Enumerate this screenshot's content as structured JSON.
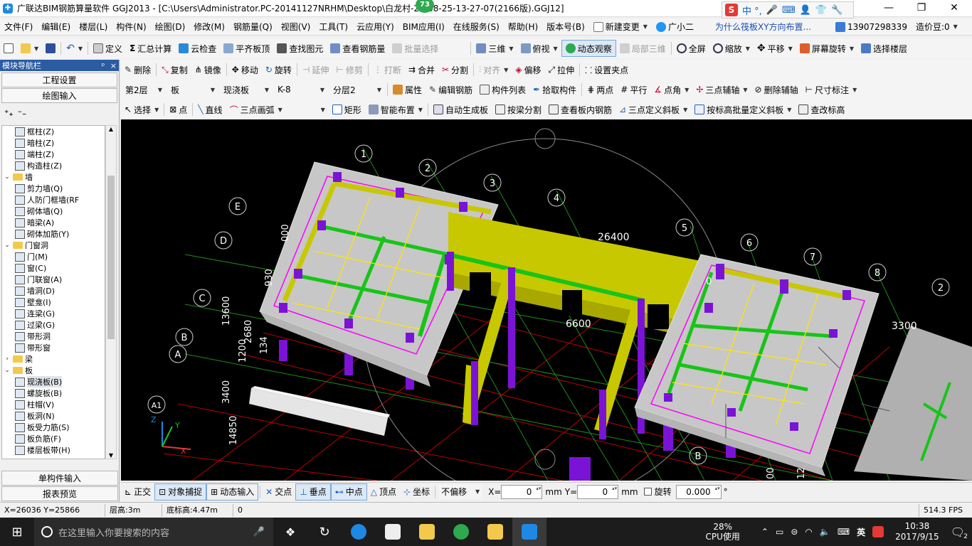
{
  "titlebar": {
    "title": "广联达BIM钢筋算量软件 GGJ2013 - [C:\\Users\\Administrator.PC-20141127NRHM\\Desktop\\白龙村-2…08-25-13-27-07(2166版).GGJ12]",
    "badge": "73",
    "ime_text": "中 °,",
    "ime_logo": "S"
  },
  "menu": {
    "items": [
      "文件(F)",
      "编辑(E)",
      "楼层(L)",
      "构件(N)",
      "绘图(D)",
      "修改(M)",
      "钢筋量(Q)",
      "视图(V)",
      "工具(T)",
      "云应用(Y)",
      "BIM应用(I)",
      "在线服务(S)",
      "帮助(H)",
      "版本号(B)"
    ],
    "new_change": "新建变更",
    "assistant": "广小二",
    "question": "为什么筏板XY方向布置...",
    "phone": "13907298339",
    "beans": "造价豆:0"
  },
  "toolbar1": {
    "define": "定义",
    "sum_calc": "汇总计算",
    "cloud_check": "云检查",
    "flush_top": "平齐板顶",
    "find_element": "查找图元",
    "view_rebar": "查看钢筋量",
    "batch_select": "批量选择",
    "view_3d": "三维",
    "top_view": "俯视",
    "dynamic_view": "动态观察",
    "local_3d": "局部三维",
    "fullscreen": "全屏",
    "zoom": "缩放",
    "pan": "平移",
    "rotate_screen": "屏幕旋转",
    "select_floor": "选择楼层"
  },
  "toolbar2": {
    "delete": "删除",
    "copy": "复制",
    "mirror": "镜像",
    "move": "移动",
    "rotate": "旋转",
    "extend": "延伸",
    "trim": "修剪",
    "break": "打断",
    "merge": "合并",
    "split": "分割",
    "align": "对齐",
    "offset": "偏移",
    "stretch": "拉伸",
    "set_grip": "设置夹点"
  },
  "toolbar3": {
    "floor": "第2层",
    "category": "板",
    "type": "现浇板",
    "element": "K-8",
    "layer": "分层2",
    "attributes": "属性",
    "edit_rebar": "编辑钢筋",
    "component_list": "构件列表",
    "pick_component": "拾取构件",
    "two_points": "两点",
    "parallel": "平行",
    "point_angle": "点角",
    "three_point_axis": "三点辅轴",
    "delete_axis": "删除辅轴",
    "dimension": "尺寸标注"
  },
  "toolbar4": {
    "select": "选择",
    "point": "点",
    "line": "直线",
    "three_point_arc": "三点画弧",
    "rectangle": "矩形",
    "smart_layout": "智能布置",
    "auto_slab": "自动生成板",
    "split_by_beam": "按梁分割",
    "view_slab_rebar": "查看板内钢筋",
    "three_point_slope": "三点定义斜板",
    "batch_slope": "按标高批量定义斜板",
    "modify_elev": "查改标高"
  },
  "nav": {
    "header": "模块导航栏",
    "pin": "ᵖ",
    "close": "×",
    "project_settings": "工程设置",
    "drawing_input": "绘图输入",
    "single_input": "单构件输入",
    "report_preview": "报表预览",
    "tree": [
      {
        "label": "框柱(Z)",
        "level": 2
      },
      {
        "label": "暗柱(Z)",
        "level": 2
      },
      {
        "label": "端柱(Z)",
        "level": 2
      },
      {
        "label": "构造柱(Z)",
        "level": 2
      },
      {
        "label": "墙",
        "level": 1,
        "folder": true,
        "open": true
      },
      {
        "label": "剪力墙(Q)",
        "level": 2
      },
      {
        "label": "人防门框墙(RF",
        "level": 2
      },
      {
        "label": "砌体墙(Q)",
        "level": 2
      },
      {
        "label": "暗梁(A)",
        "level": 2
      },
      {
        "label": "砌体加筋(Y)",
        "level": 2
      },
      {
        "label": "门窗洞",
        "level": 1,
        "folder": true,
        "open": true
      },
      {
        "label": "门(M)",
        "level": 2
      },
      {
        "label": "窗(C)",
        "level": 2
      },
      {
        "label": "门联窗(A)",
        "level": 2
      },
      {
        "label": "墙洞(D)",
        "level": 2
      },
      {
        "label": "壁龛(I)",
        "level": 2
      },
      {
        "label": "连梁(G)",
        "level": 2
      },
      {
        "label": "过梁(G)",
        "level": 2
      },
      {
        "label": "带形洞",
        "level": 2
      },
      {
        "label": "带形窗",
        "level": 2
      },
      {
        "label": "梁",
        "level": 1,
        "folder": true,
        "open": false
      },
      {
        "label": "板",
        "level": 1,
        "folder": true,
        "open": true
      },
      {
        "label": "现浇板(B)",
        "level": 2,
        "selected": true
      },
      {
        "label": "螺旋板(B)",
        "level": 2
      },
      {
        "label": "柱帽(V)",
        "level": 2
      },
      {
        "label": "板洞(N)",
        "level": 2
      },
      {
        "label": "板受力筋(S)",
        "level": 2
      },
      {
        "label": "板负筋(F)",
        "level": 2
      },
      {
        "label": "楼层板带(H)",
        "level": 2
      }
    ]
  },
  "viewport": {
    "axis_labels": [
      "1",
      "2",
      "3",
      "4",
      "5",
      "6",
      "7",
      "8",
      "2",
      "E",
      "D",
      "C",
      "B",
      "A",
      "A1",
      "B"
    ],
    "dim_26400": "26400",
    "dim_6600": "6600",
    "dim_3300": "3300",
    "dim_left": [
      "13600",
      "1200",
      "3400",
      "14850",
      "2680",
      "134",
      "000",
      "930"
    ],
    "dim_right": [
      "0",
      "00",
      "12"
    ],
    "axis_x": "X",
    "axis_y": "Y",
    "axis_z": "Z",
    "colors": {
      "slab": "#c7c7c7",
      "wall": "#c8c800",
      "beam_green": "#18c418",
      "column": "#7b13d6",
      "rebar_magenta": "#ff00ff",
      "rebar_yellow": "#ffe600",
      "grid_red": "#d00000",
      "grid_green": "#1c8c1c"
    }
  },
  "snap": {
    "ortho": "正交",
    "object_snap": "对象捕捉",
    "dynamic_input": "动态输入",
    "intersection": "交点",
    "perpendicular": "垂点",
    "midpoint": "中点",
    "vertex": "顶点",
    "coordinate": "坐标",
    "offset_mode": "不偏移",
    "x_label": "X=",
    "x_value": "0",
    "y_label": "Y=",
    "y_value": "0",
    "mm1": "mm",
    "mm2": "mm",
    "rotate_label": "旋转",
    "rotate_value": "0.000",
    "degree": "°"
  },
  "status": {
    "coords": "X=26036 Y=25866",
    "floor_height": "层高:3m",
    "base_elev": "底标高:4.47m",
    "zero": "0",
    "fps": "514.3 FPS"
  },
  "taskbar": {
    "search_placeholder": "在这里输入你要搜索的内容",
    "cpu_percent": "28%",
    "cpu_label": "CPU使用",
    "ime": "英",
    "time": "10:38",
    "date": "2017/9/15",
    "notif": "2"
  }
}
